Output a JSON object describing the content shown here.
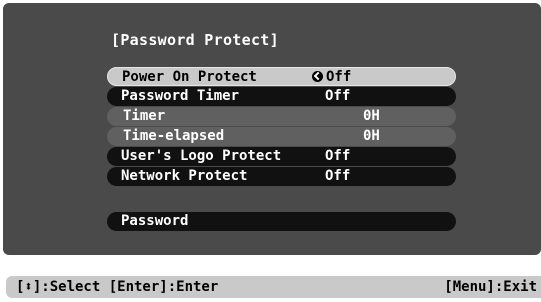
{
  "menu": {
    "title": "[Password Protect]",
    "items": [
      {
        "label": "Power On Protect",
        "value": "Off",
        "selected": true,
        "sub": false,
        "icon": "enter-icon"
      },
      {
        "label": "Password Timer",
        "value": "Off",
        "selected": false,
        "sub": false
      },
      {
        "label": "Timer",
        "value": "0H",
        "selected": false,
        "sub": true
      },
      {
        "label": "Time-elapsed",
        "value": "0H",
        "selected": false,
        "sub": true
      },
      {
        "label": "User's Logo Protect",
        "value": "Off",
        "selected": false,
        "sub": false
      },
      {
        "label": "Network Protect",
        "value": "Off",
        "selected": false,
        "sub": false
      },
      {
        "label": "Password",
        "value": "",
        "selected": false,
        "sub": false
      }
    ]
  },
  "statusbar": {
    "select_hint": "[⬍]:Select [Enter]:Enter",
    "exit_hint": "[Menu]:Exit"
  },
  "colors": {
    "panel_bg": "#4a4a4a",
    "item_bg": "#111111",
    "selected_bg": "#c9c9c9",
    "sub_item_bg": "#606060"
  }
}
